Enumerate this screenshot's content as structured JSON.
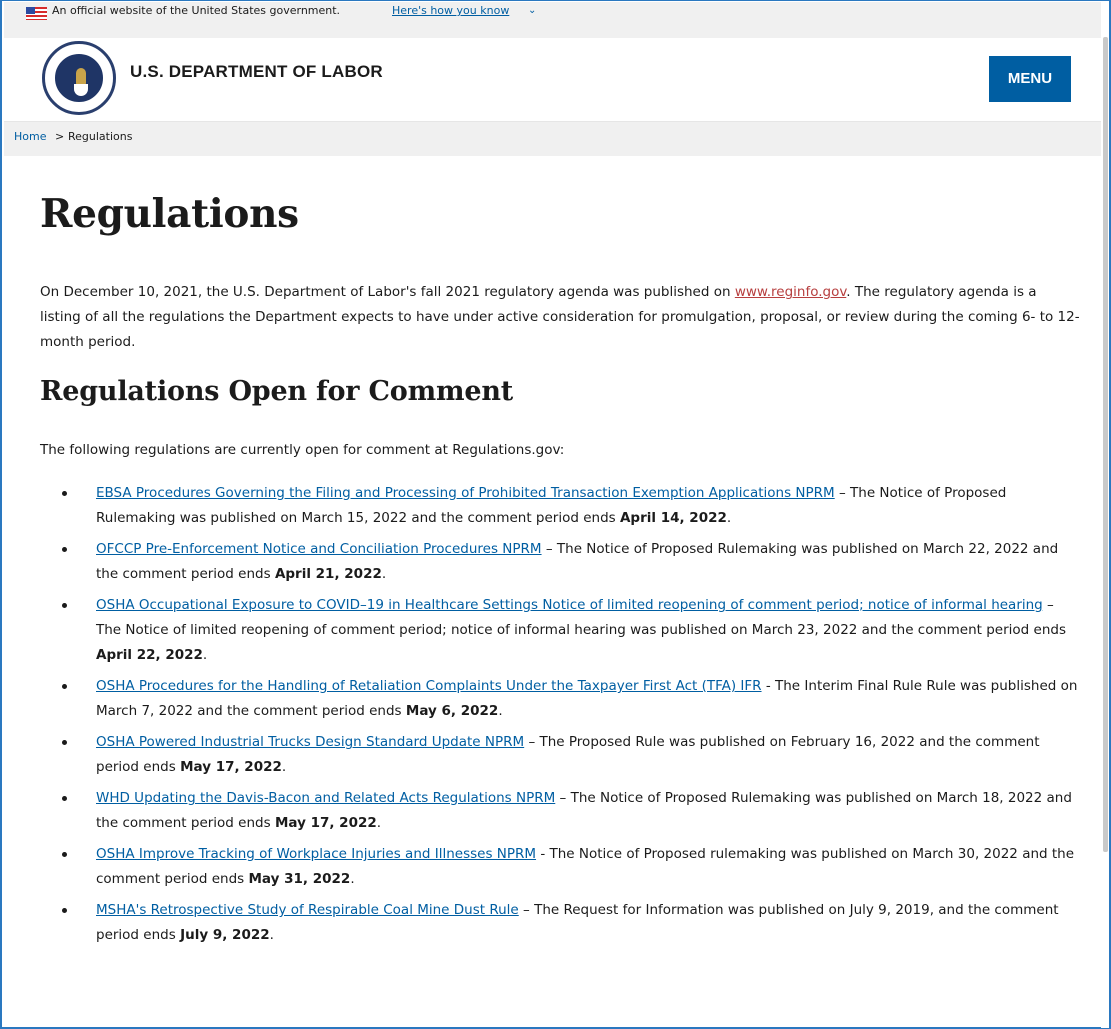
{
  "gov_banner": {
    "text": "An official website of the United States government.",
    "link": "Here's how you know",
    "chevron": "⌄"
  },
  "header": {
    "agency_name": "U.S. DEPARTMENT OF LABOR",
    "menu_label": "MENU"
  },
  "breadcrumb": {
    "home": "Home",
    "separator": ">",
    "current": "Regulations"
  },
  "main": {
    "title": "Regulations",
    "intro_before": "On December 10, 2021, the U.S. Department of Labor's fall 2021 regulatory agenda was published on ",
    "intro_link": "www.reginfo.gov",
    "intro_after": ". The regulatory agenda is a listing of all the regulations the Department expects to have under active consideration for promulgation, proposal, or review during the coming 6- to 12-month period.",
    "section_title": "Regulations Open for Comment",
    "section_lead": "The following regulations are currently open for comment at Regulations.gov:",
    "regulations": [
      {
        "link": "EBSA Procedures Governing the Filing and Processing of Prohibited Transaction Exemption Applications NPRM",
        "text": " – The Notice of Proposed Rulemaking was published on March 15, 2022 and the comment period ends ",
        "deadline": "April 14, 2022",
        "end": "."
      },
      {
        "link": "OFCCP Pre-Enforcement Notice and Conciliation Procedures NPRM",
        "text": " – The Notice of Proposed Rulemaking was published on March 22, 2022 and the comment period ends ",
        "deadline": "April 21, 2022",
        "end": "."
      },
      {
        "link": "OSHA Occupational Exposure to COVID–19 in Healthcare Settings Notice of limited reopening of comment period; notice of informal hearing",
        "text": " – The Notice of limited reopening of comment period; notice of informal hearing was published on March 23, 2022 and the comment period ends ",
        "deadline": "April 22, 2022",
        "end": "."
      },
      {
        "link": "OSHA Procedures for the Handling of Retaliation Complaints Under the Taxpayer First Act (TFA) IFR",
        "text": " - The Interim Final Rule Rule was published on March 7, 2022 and the comment period ends ",
        "deadline": "May 6, 2022",
        "end": "."
      },
      {
        "link": "OSHA Powered Industrial Trucks Design Standard Update NPRM",
        "text": " – The Proposed Rule was published on February 16, 2022 and the comment period ends ",
        "deadline": "May 17, 2022",
        "end": "."
      },
      {
        "link": "WHD Updating the Davis-Bacon and Related Acts Regulations NPRM",
        "text": " – The Notice of Proposed Rulemaking was published on March 18, 2022 and the comment period ends ",
        "deadline": "May 17, 2022",
        "end": "."
      },
      {
        "link": "OSHA Improve Tracking of Workplace Injuries and Illnesses NPRM",
        "text": " - The Notice of Proposed rulemaking was published on March 30, 2022 and the comment period ends ",
        "deadline": "May 31, 2022",
        "end": "."
      },
      {
        "link": "MSHA's Retrospective Study of Respirable Coal Mine Dust Rule",
        "text": " – The Request for Information was published on July 9, 2019, and the comment period ends ",
        "deadline": "July 9, 2022",
        "end": "."
      }
    ]
  },
  "colors": {
    "primary_blue": "#005ea2",
    "reginfo_link": "#b73f3f",
    "banner_bg": "#f0f0f0",
    "frame_border": "#2a78c0"
  },
  "icons": [
    "us-flag-icon",
    "dol-seal-icon",
    "chevron-down-icon",
    "chevron-right-icon"
  ]
}
